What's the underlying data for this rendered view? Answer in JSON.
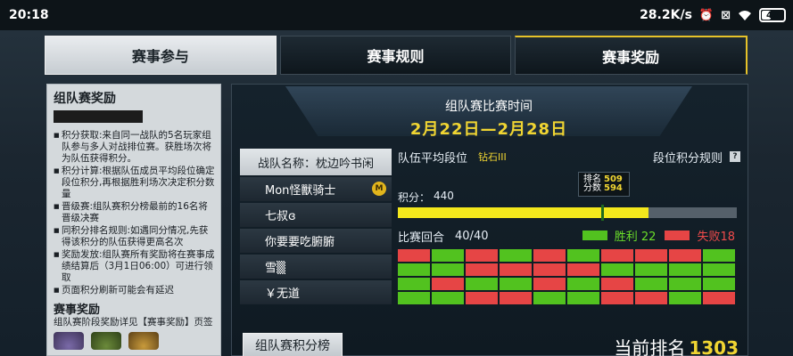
{
  "status": {
    "time": "20:18",
    "network_speed": "28.2K/s",
    "battery": "48",
    "battery_level": 0.48,
    "icons": [
      "alarm-icon",
      "close-box-icon",
      "wifi-icon",
      "battery-icon"
    ]
  },
  "tabs": [
    {
      "label": "赛事参与",
      "active": true
    },
    {
      "label": "赛事规则",
      "active": false
    },
    {
      "label": "赛事奖励",
      "active": false
    }
  ],
  "left": {
    "title": "组队赛奖励",
    "rules": [
      "积分获取:来自同一战队的5名玩家组队参与多人对战排位赛。获胜场次将为队伍获得积分。",
      "积分计算:根据队伍成员平均段位确定段位积分,再根据胜利场次决定积分数量",
      "晋级赛:组队赛积分榜最前的16名将晋级决赛",
      "同积分排名规则:如遇同分情况,先获得该积分的队伍获得更高名次",
      "奖励发放:组队赛所有奖励将在赛事成绩结算后（3月1日06:00）可进行领取",
      "页面积分刷新可能会有延迟"
    ],
    "section2_title": "赛事奖励",
    "section2_text": "组队赛阶段奖励详见【赛事奖励】页签"
  },
  "main": {
    "banner_title": "组队赛比赛时间",
    "banner_date": "2月22日—2月28日",
    "team_name": "战队名称：枕边吟书闲",
    "members": [
      {
        "name": "Mon怪獸骑士",
        "badge": "M"
      },
      {
        "name": "七叔ɞ",
        "badge": ""
      },
      {
        "name": "你要要吃腑腑",
        "badge": ""
      },
      {
        "name": "雪▒",
        "badge": ""
      },
      {
        "name": "￥无道",
        "badge": ""
      }
    ],
    "avg_rank_label": "队伍平均段位",
    "avg_rank_value": "钻石III",
    "rules_label": "段位积分规则",
    "help_icon": "?",
    "tooltip_label": "排名分数",
    "tooltip_values": [
      "509",
      "594"
    ],
    "score_label": "积分：",
    "score_value": "440",
    "score_progress": 0.74,
    "score_marker": 0.6,
    "rounds_label": "比赛回合",
    "rounds_value": "40/40",
    "win_label": "胜利 22",
    "loss_label": "失败18",
    "win_color": "#52c21f",
    "loss_color": "#e64545",
    "results": [
      "L",
      "W",
      "L",
      "W",
      "L",
      "W",
      "L",
      "L",
      "L",
      "W",
      "W",
      "W",
      "L",
      "L",
      "L",
      "L",
      "W",
      "W",
      "W",
      "W",
      "W",
      "L",
      "W",
      "W",
      "L",
      "W",
      "L",
      "W",
      "W",
      "W",
      "W",
      "W",
      "L",
      "L",
      "W",
      "W",
      "L",
      "L",
      "W",
      "L"
    ],
    "leaderboard_button": "组队赛积分榜",
    "current_rank_label": "当前排名",
    "current_rank_value": "1303"
  }
}
